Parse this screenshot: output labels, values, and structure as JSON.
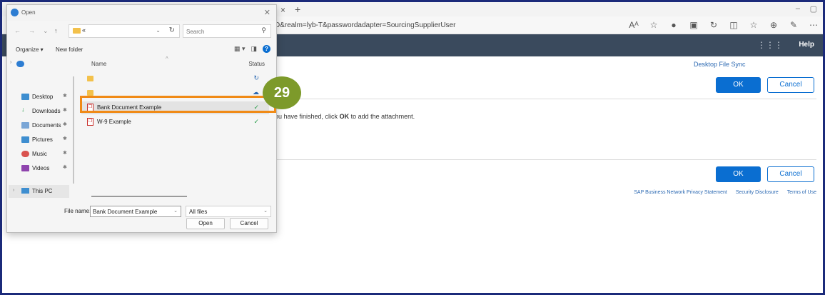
{
  "browser": {
    "url": "D&realm=lyb-T&passwordadapter=SourcingSupplierUser",
    "tab_close": "×",
    "new_tab": "+",
    "min": "–",
    "max": "▢",
    "icons": [
      "Aᴬ",
      "☆",
      "●",
      "▣",
      "↻",
      "◫",
      "☆",
      "⊕",
      "✎",
      "⋯"
    ]
  },
  "app_header": {
    "help_label": "Help"
  },
  "page": {
    "desktop_file_sync": "Desktop File Sync",
    "ok_label": "OK",
    "cancel_label": "Cancel",
    "instruction_prefix": "ou have finished, click ",
    "instruction_bold": "OK",
    "instruction_suffix": " to add the attachment.",
    "footer_links": [
      "SAP Business Network Privacy Statement",
      "Security Disclosure",
      "Terms of Use"
    ]
  },
  "dialog": {
    "title": "Open",
    "path_text": "«",
    "search_placeholder": "Search",
    "organize_label": "Organize ▾",
    "new_folder_label": "New folder",
    "nav_items": [
      {
        "label": "Desktop",
        "color": "#3e8ed0"
      },
      {
        "label": "Downloads",
        "color": "#2a9d4b"
      },
      {
        "label": "Documents",
        "color": "#7aa6d6"
      },
      {
        "label": "Pictures",
        "color": "#3e8ed0"
      },
      {
        "label": "Music",
        "color": "#d9534f"
      },
      {
        "label": "Videos",
        "color": "#8e44ad"
      }
    ],
    "this_pc_label": "This PC",
    "columns": {
      "name": "Name",
      "status": "Status"
    },
    "files": [
      {
        "name": "",
        "type": "folder",
        "status": "↻"
      },
      {
        "name": "",
        "type": "folder",
        "status": "☁"
      },
      {
        "name": "Bank Document Example",
        "type": "pdf",
        "status": "✓"
      },
      {
        "name": "W-9 Example",
        "type": "pdf",
        "status": "✓"
      }
    ],
    "file_name_label": "File name:",
    "file_name_value": "Bank Document Example",
    "filter_value": "All files",
    "open_label": "Open",
    "cancel_label": "Cancel"
  },
  "annotation": {
    "step_number": "29",
    "highlight_color": "#f08a16",
    "badge_color": "#7d9a2a"
  }
}
